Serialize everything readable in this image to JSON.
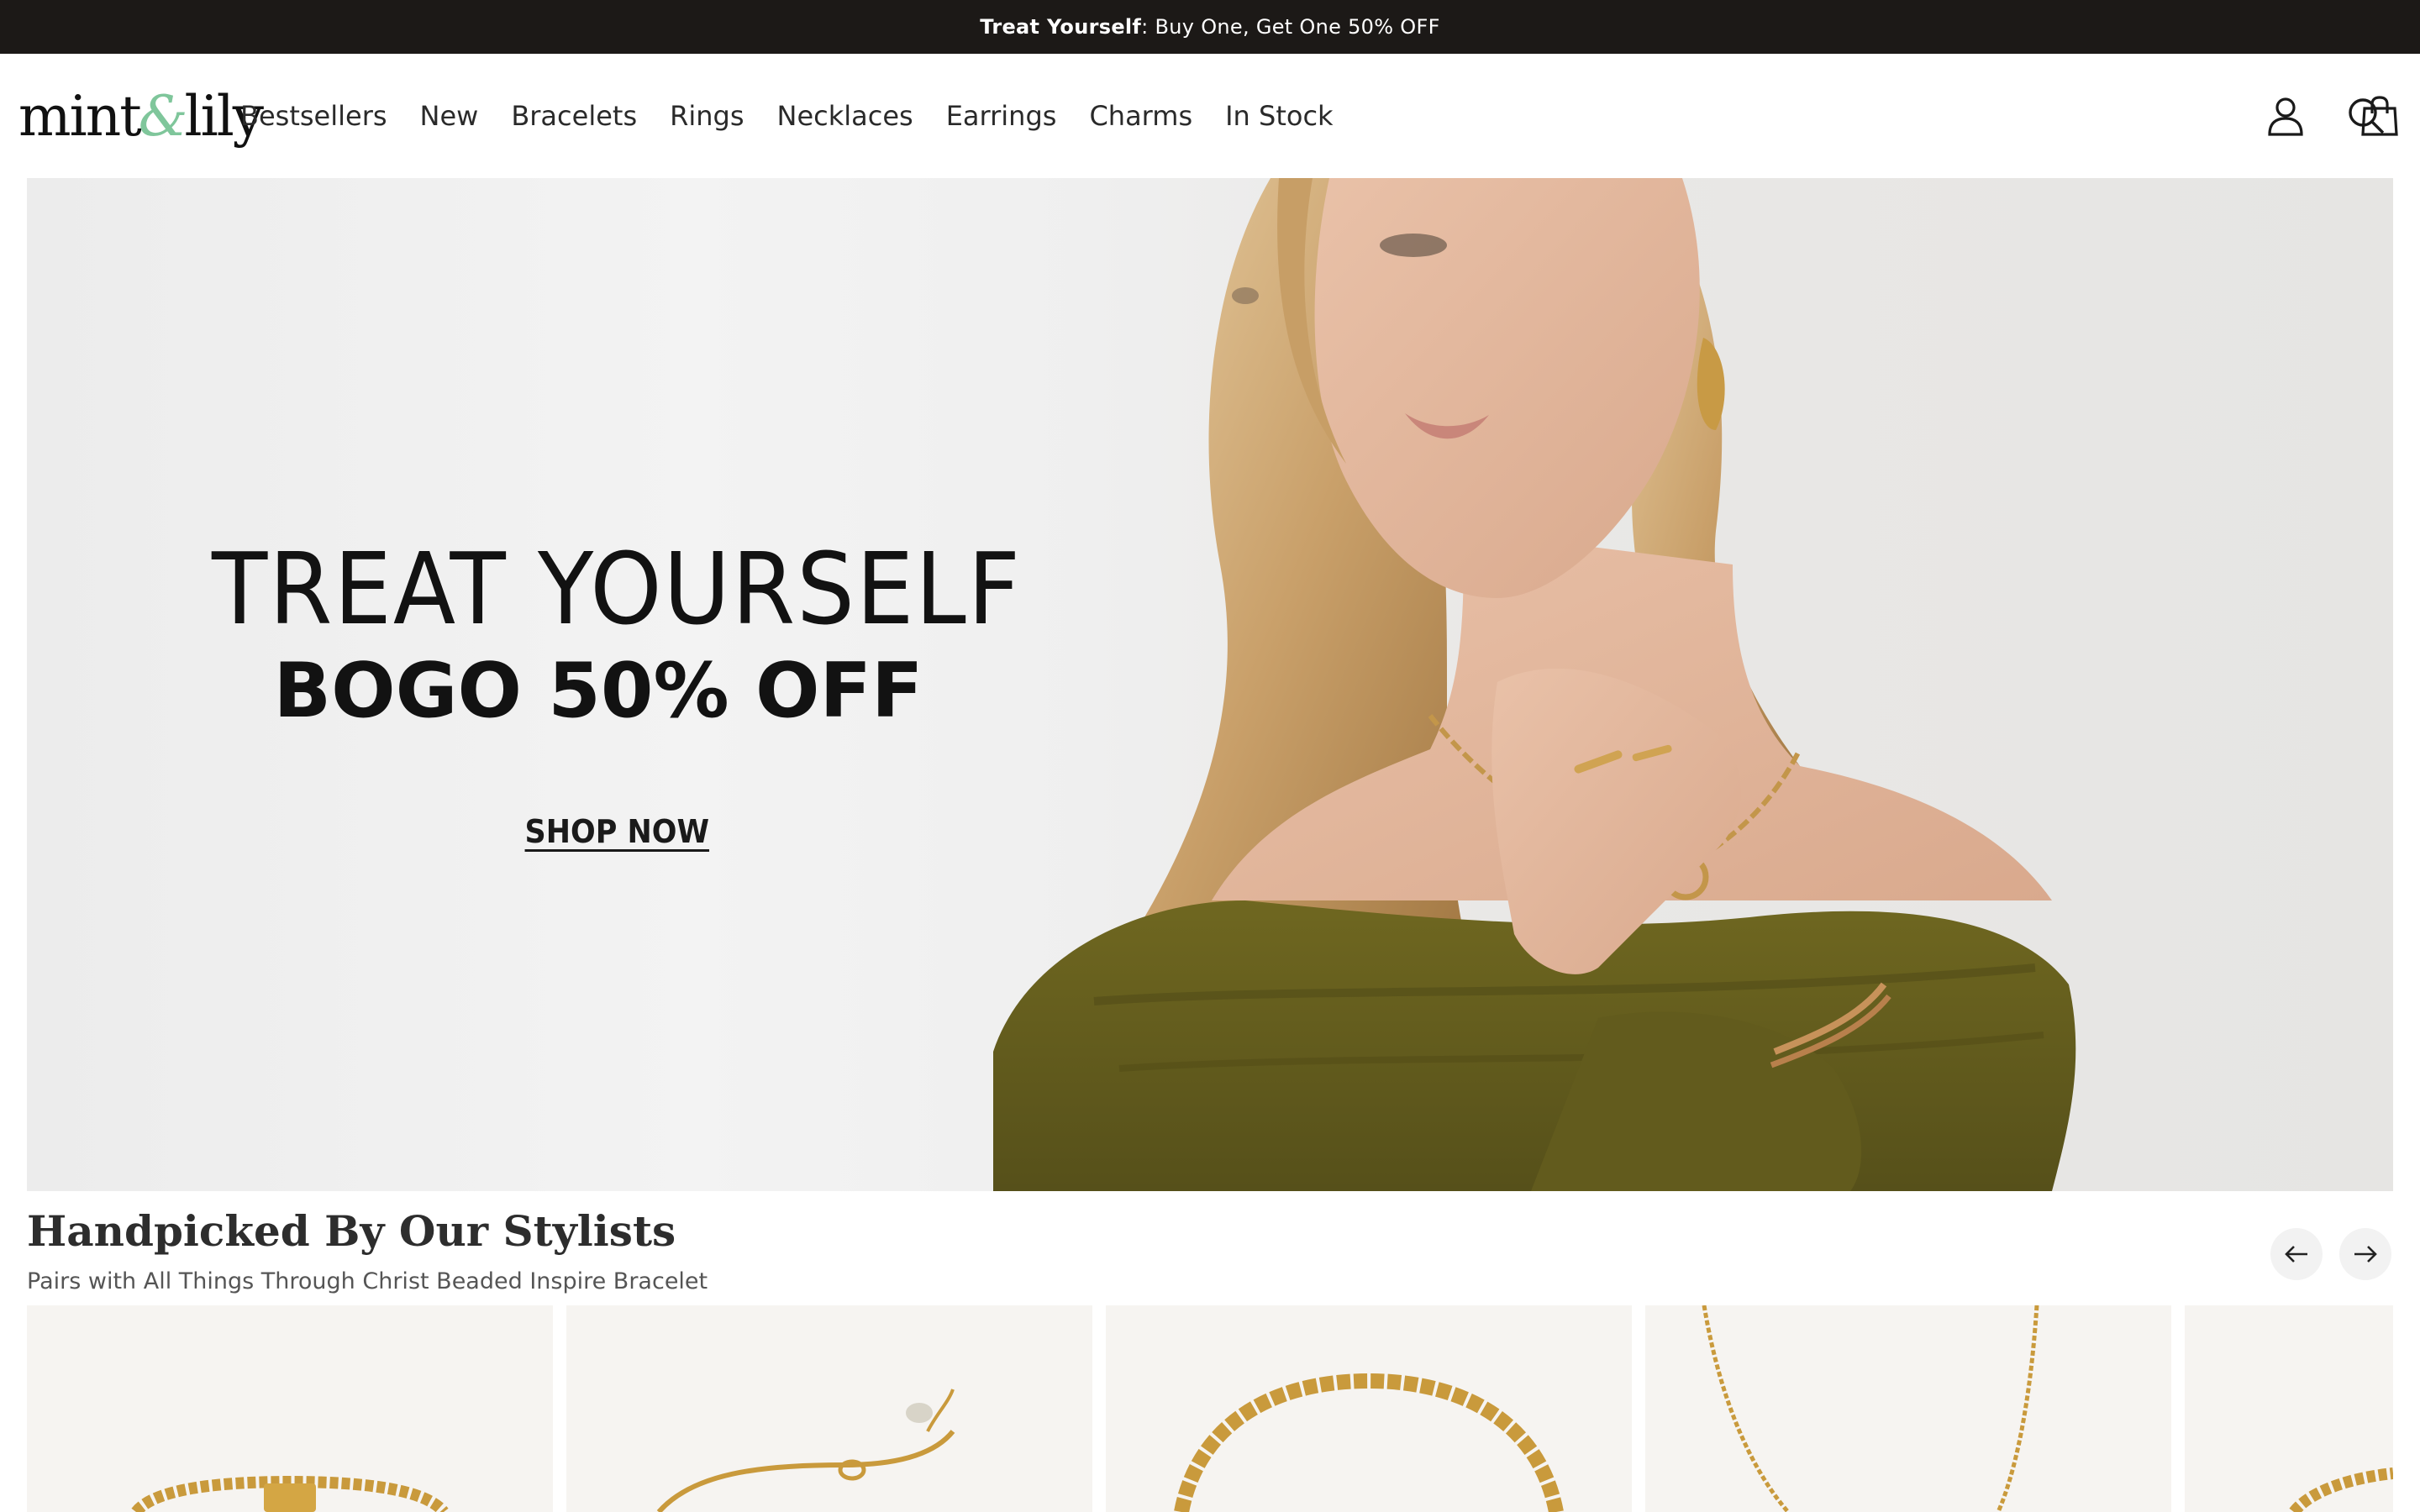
{
  "announcement": {
    "bold": "Treat Yourself",
    "text": ": Buy One, Get One 50% OFF"
  },
  "brand": {
    "logo_left": "mint",
    "logo_amp": "&",
    "logo_right": "lily",
    "accent_color": "#7fc69b"
  },
  "nav": {
    "items": [
      "Bestsellers",
      "New",
      "Bracelets",
      "Rings",
      "Necklaces",
      "Earrings",
      "Charms",
      "In Stock"
    ]
  },
  "header_icons": [
    "account-icon",
    "search-icon",
    "cart-icon"
  ],
  "hero": {
    "title": "TREAT YOURSELF",
    "subtitle": "BOGO 50% OFF",
    "cta": "SHOP NOW"
  },
  "section": {
    "title": "Handpicked By Our Stylists",
    "subtitle": "Pairs with All Things Through Christ Beaded Inspire Bracelet",
    "prev_icon": "arrow-left-icon",
    "next_icon": "arrow-right-icon"
  },
  "products": [
    {
      "image": "gold-beaded-bracelet"
    },
    {
      "image": "gold-chain-bracelet"
    },
    {
      "image": "gold-beaded-bracelet-round"
    },
    {
      "image": "gold-chain-necklace"
    },
    {
      "image": "gold-beaded-bracelet-partial"
    }
  ]
}
